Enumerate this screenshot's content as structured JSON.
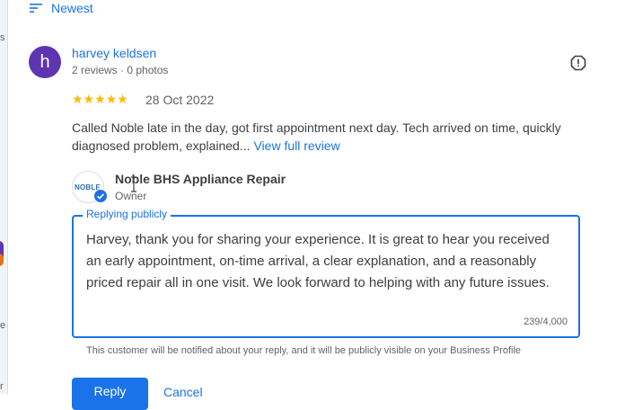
{
  "left_fragments": [
    "s",
    "e",
    "r"
  ],
  "sort": {
    "label": "Newest",
    "icon": "sort-icon"
  },
  "review": {
    "avatar_letter": "h",
    "reviewer_name": "harvey keldsen",
    "reviewer_meta": "2 reviews · 0 photos",
    "rating": 5,
    "stars": "★★★★★",
    "date": "28 Oct 2022",
    "text": "Called Noble late in the day, got first appointment next day. Tech arrived on time, quickly diagnosed problem, explained...",
    "view_full": "View full review"
  },
  "business": {
    "logo_text": "NOBLE",
    "name": "Noble BHS Appliance Repair",
    "role": "Owner"
  },
  "reply": {
    "label": "Replying publicly",
    "text": "Harvey, thank you for sharing your experience. It is great to hear you received an early appointment, on-time arrival, a clear explanation, and a reasonably priced repair all in one visit. We look forward to helping with any future issues.",
    "counter": "239/4,000",
    "notice": "This customer will be notified about your reply, and it will be publicly visible on your Business Profile"
  },
  "actions": {
    "reply_label": "Reply",
    "cancel_label": "Cancel"
  },
  "colors": {
    "accent": "#1a73e8",
    "avatar": "#5e35b1",
    "star": "#fbbc04"
  }
}
